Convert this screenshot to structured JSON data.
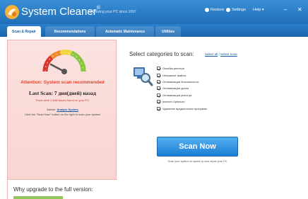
{
  "window": {
    "title": "System Cleaner",
    "title_mark": "®",
    "tagline": "Optimizing your PC since 1997",
    "toolbar": {
      "restore_label": "Restore",
      "settings_label": "Settings",
      "help_label": "Help ▾"
    },
    "controls": {
      "minimize": "–",
      "close": "✕"
    }
  },
  "tabs": [
    {
      "label": "Scan & Repair",
      "active": true
    },
    {
      "label": "Recommendations",
      "active": false
    },
    {
      "label": "Automatic Maintenance",
      "active": false
    },
    {
      "label": "Utilities",
      "active": false
    }
  ],
  "status": {
    "attention": "Attention: System scan recommended",
    "last_scan": "Last Scan: 7 дня(дней) назад",
    "issues_line": "There were 2,638 issues found on your PC.",
    "advice_prefix": "Advice: ",
    "advice_link": "Analyze System",
    "hint": "Click the \"Scan Now\" button on the right to scan your system"
  },
  "upgrade": {
    "title": "Why upgrade to the full version:"
  },
  "scan": {
    "heading": "Select categories to scan:",
    "select_all": "Select all",
    "separator": " | ",
    "select_none": "Select none",
    "categories": [
      "Ошибки реестра",
      "Ненужные файлы",
      "Оптимизация безопасности",
      "Оптимизация диска",
      "Оптимизация реестра",
      "Internet Optimizer",
      "Удаление вредоносных программ"
    ],
    "button_label": "Scan Now",
    "subtitle": "Scan your system to speed up and repair your PC"
  },
  "colors": {
    "titlebar": "#2a80cc",
    "attention": "#e2442f",
    "panel_bg": "#f9d9d6",
    "scan_button": "#2a8ae0"
  }
}
